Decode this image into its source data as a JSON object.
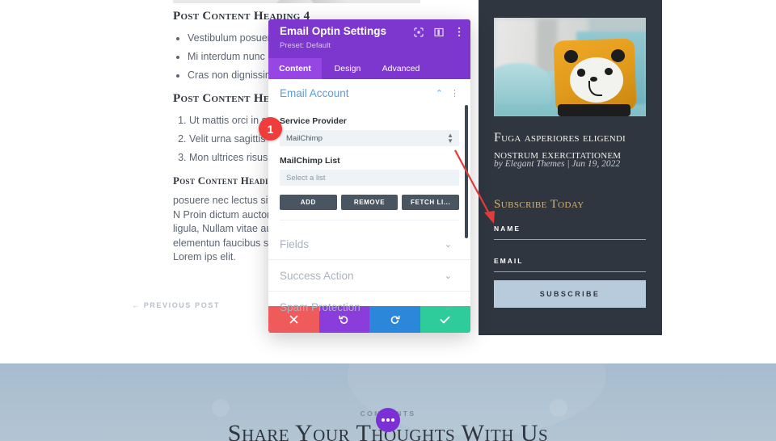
{
  "background": {
    "headings": [
      "Post Content Heading 4",
      "Post Content Heading",
      "Post Content Heading"
    ],
    "bullets": [
      "Vestibulum posuere",
      "Mi interdum nunc dignissi",
      "Cras non dignissim quam"
    ],
    "numbered": [
      "Ut mattis orci in scelerisq",
      "Velit urna sagittis arcu",
      "Mon ultrices risus lectus"
    ],
    "paragraph": "posuere nec lectus sit amet, ac fermentum accumsan. N Proin dictum auctor mi, eu c ligula. Praesent purus ligula, Nullam vitae augue aliquet, euismod, sem et elementun faucibus sapien neque quis porttitor volutpat. Lorem ips elit.",
    "previous_post": "← PREVIOUS POST"
  },
  "sidebar": {
    "post_title": "Fuga asperiores eligendi nostrum exercitationem",
    "post_meta": "by Elegant Themes | Jun 19, 2022",
    "optin_heading": "Subscribe Today",
    "fields": [
      {
        "label": "NAME"
      },
      {
        "label": "EMAIL"
      }
    ],
    "submit_label": "SUBSCRIBE",
    "photo_alt": "panda-cushion-photo"
  },
  "comments_section": {
    "label": "COMMENTS",
    "title": "Share Your Thoughts With Us"
  },
  "modal": {
    "title": "Email Optin Settings",
    "preset": "Preset: Default",
    "header_icons": [
      "fullscreen-icon",
      "layout-icon",
      "more-options-icon"
    ],
    "tabs": [
      {
        "label": "Content",
        "active": true
      },
      {
        "label": "Design",
        "active": false
      },
      {
        "label": "Advanced",
        "active": false
      }
    ],
    "sections": [
      {
        "title": "Email Account",
        "expanded": true
      },
      {
        "title": "Fields",
        "expanded": false
      },
      {
        "title": "Success Action",
        "expanded": false
      },
      {
        "title": "Spam Protection",
        "expanded": false
      }
    ],
    "email_account": {
      "service_provider_label": "Service Provider",
      "service_provider_value": "MailChimp",
      "list_label": "MailChimp List",
      "list_placeholder": "Select a list",
      "buttons": [
        "ADD",
        "REMOVE",
        "FETCH LI..."
      ]
    },
    "footer_buttons": [
      {
        "name": "cancel",
        "glyph": "✖",
        "color": "#ef5a5a"
      },
      {
        "name": "undo",
        "glyph": "↺",
        "color": "#8b3ddb"
      },
      {
        "name": "redo",
        "glyph": "↻",
        "color": "#2b87da"
      },
      {
        "name": "save",
        "glyph": "✔",
        "color": "#2ecc9b"
      }
    ]
  },
  "annotations": {
    "step_badge": "1",
    "arrow_color": "#e23b3b"
  },
  "colors": {
    "modal_purple": "#7d37cf",
    "tab_active": "#9647e3",
    "sidebar_dark": "#2f3640",
    "optin_gold": "#d9b26a",
    "subscribe_blue": "#b7cbdd",
    "comments_bg": "#a6bccf"
  }
}
